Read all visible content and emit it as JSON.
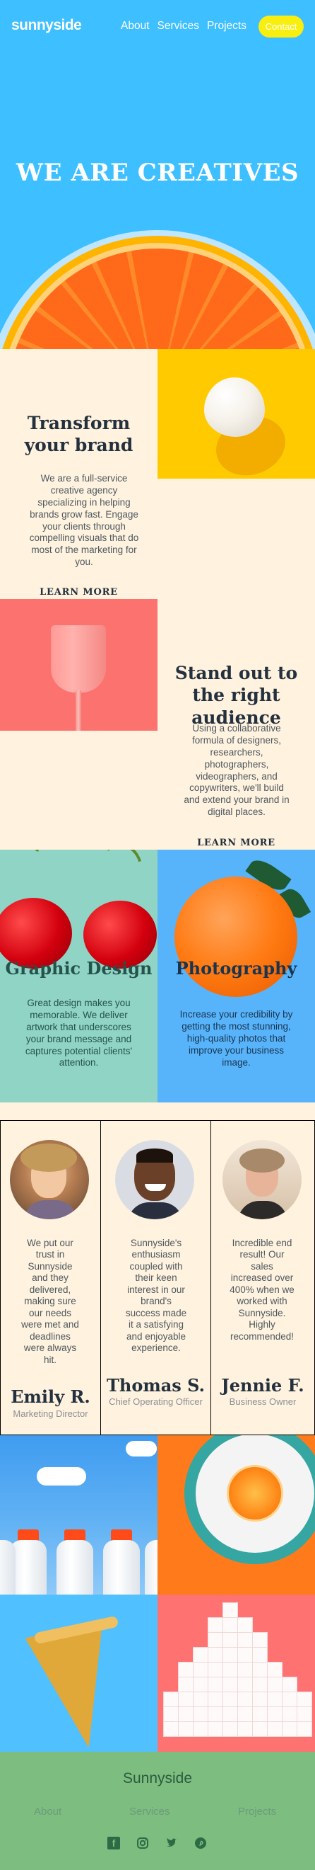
{
  "header": {
    "logo": "sunnyside",
    "nav": [
      "About",
      "Services",
      "Projects"
    ],
    "contact": "Contact"
  },
  "hero": {
    "title": "WE ARE CREATIVES"
  },
  "transform": {
    "title": "Transform your brand",
    "text": "We are a full-service creative agency specializing in helping brands grow fast. Engage your clients through compelling visuals that do most of the marketing for you.",
    "link": "LEARN MORE",
    "accent": "#fad400"
  },
  "standout": {
    "title": "Stand out to the right audience",
    "text": "Using a collaborative formula of designers, researchers, photographers, videographers, and copywriters, we'll build and extend your brand in digital places.",
    "link": "LEARN MORE",
    "accent": "#fe7a66"
  },
  "graphic": {
    "title": "Graphic Design",
    "text": "Great design makes you memorable. We deliver artwork that underscores your brand message and captures potential clients' attention.",
    "title_color": "#24534b",
    "text_color": "#24534b"
  },
  "photography": {
    "title": "Photography",
    "text": "Increase your credibility by getting the most stunning, high-quality photos that improve your business image.",
    "title_color": "#19344e",
    "text_color": "#19344e"
  },
  "testimonials": [
    {
      "text": "We put our trust in Sunnyside and they delivered, making sure our needs were met and deadlines were always hit.",
      "name": "Emily R.",
      "role": "Marketing Director"
    },
    {
      "text": "Sunnyside's enthusiasm coupled with their keen interest in our brand's success made it a satisfying and enjoyable experience.",
      "name": "Thomas S.",
      "role": "Chief Operating Officer"
    },
    {
      "text": "Incredible end result! Our sales increased over 400% when we worked with Sunnyside. Highly recommended!",
      "name": "Jennie F.",
      "role": "Business Owner"
    }
  ],
  "footer": {
    "title": "Sunnyside",
    "links": [
      "About",
      "Services",
      "Projects"
    ],
    "social": [
      "facebook-icon",
      "instagram-icon",
      "twitter-icon",
      "pinterest-icon"
    ]
  }
}
